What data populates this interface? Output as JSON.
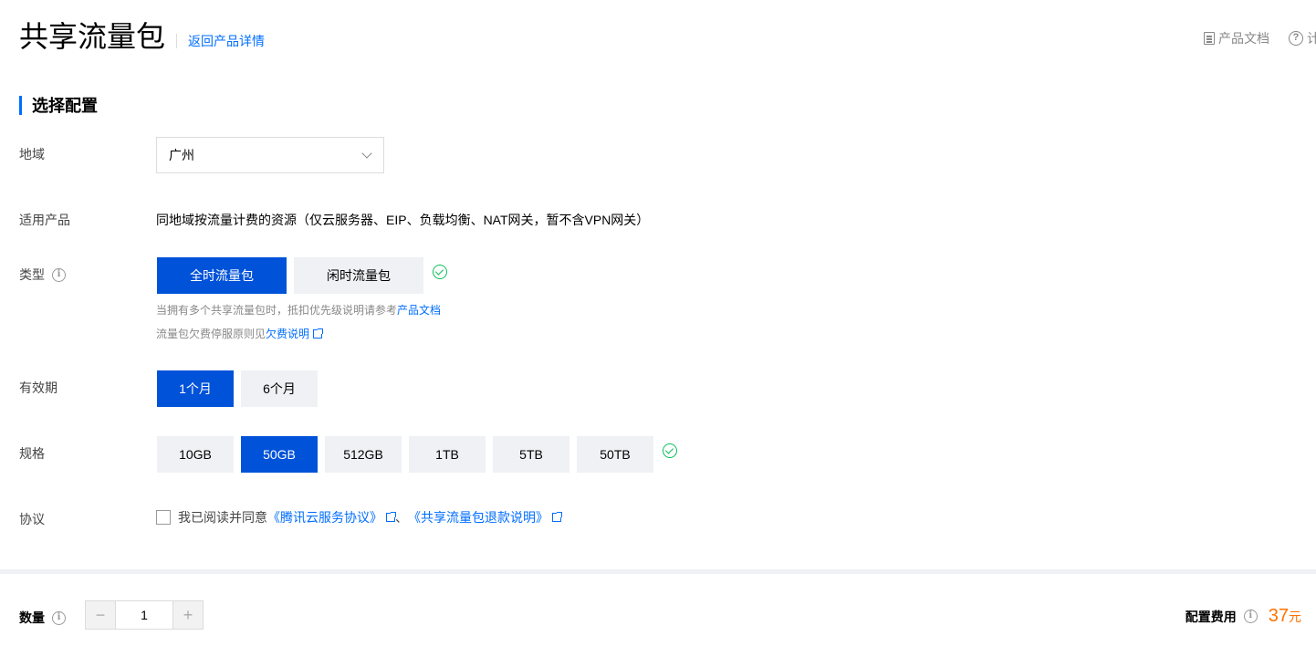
{
  "header": {
    "title": "共享流量包",
    "back_link": "返回产品详情",
    "doc_link": "产品文档",
    "help_link": "计"
  },
  "section": {
    "title": "选择配置"
  },
  "region": {
    "label": "地域",
    "value": "广州"
  },
  "product": {
    "label": "适用产品",
    "text": "同地域按流量计费的资源（仅云服务器、EIP、负载均衡、NAT网关，暂不含VPN网关）"
  },
  "type": {
    "label": "类型",
    "options": [
      "全时流量包",
      "闲时流量包"
    ],
    "selected": "全时流量包",
    "tip1_prefix": "当拥有多个共享流量包时，抵扣优先级说明请参考",
    "tip1_link": "产品文档",
    "tip2_prefix": "流量包欠费停服原则见",
    "tip2_link": "欠费说明"
  },
  "validity": {
    "label": "有效期",
    "options": [
      "1个月",
      "6个月"
    ],
    "selected": "1个月"
  },
  "spec": {
    "label": "规格",
    "options": [
      "10GB",
      "50GB",
      "512GB",
      "1TB",
      "5TB",
      "50TB"
    ],
    "selected": "50GB"
  },
  "agreement": {
    "label": "协议",
    "prefix": "我已阅读并同意",
    "link1": "《腾讯云服务协议》",
    "separator": "、",
    "link2": "《共享流量包退款说明》"
  },
  "quantity": {
    "label": "数量",
    "value": "1",
    "minus": "−",
    "plus": "+"
  },
  "fee": {
    "label": "配置费用",
    "value": "37",
    "unit": "元"
  },
  "colors": {
    "accent": "#0052d9",
    "link": "#006eff",
    "price": "#ff7200",
    "success": "#0abf5b"
  }
}
